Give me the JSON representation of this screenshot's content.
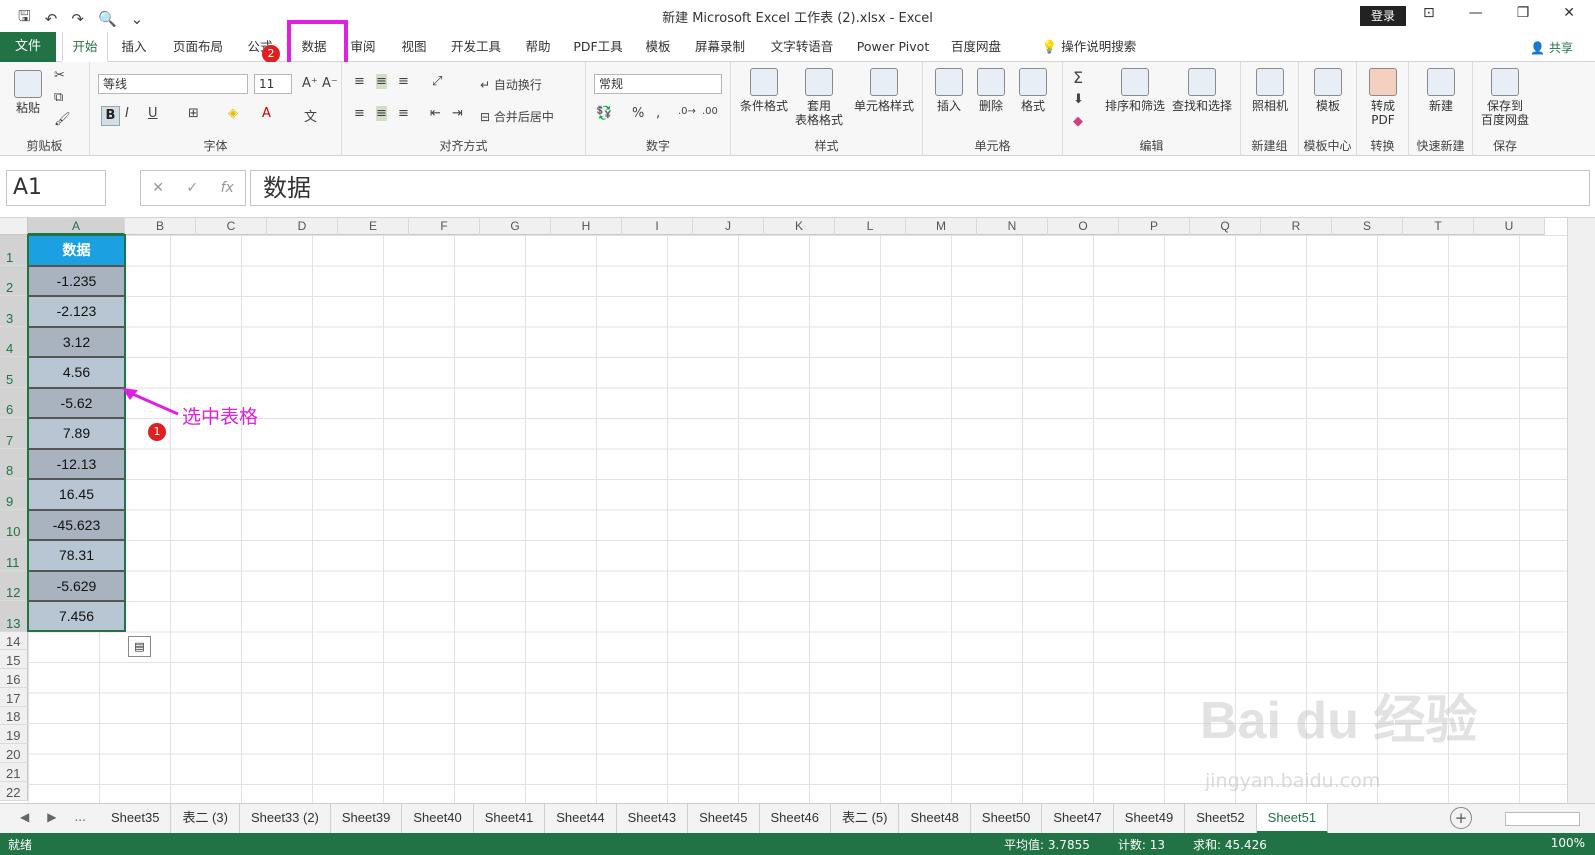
{
  "window": {
    "title": "新建 Microsoft Excel 工作表 (2).xlsx  -  Excel",
    "login_label": "登录",
    "qat_icons": [
      "save-icon",
      "undo-icon",
      "redo-icon",
      "print-preview-icon",
      "customize-icon"
    ]
  },
  "menu": {
    "file_label": "文件",
    "tabs": [
      "开始",
      "插入",
      "页面布局",
      "公式",
      "数据",
      "审阅",
      "视图",
      "开发工具",
      "帮助",
      "PDF工具",
      "模板",
      "屏幕录制",
      "文字转语音",
      "Power Pivot",
      "百度网盘"
    ],
    "active_tab": "开始",
    "search_label": "操作说明搜索",
    "share_label": "共享"
  },
  "ribbon": {
    "clipboard": {
      "label": "剪贴板",
      "paste_label": "粘贴"
    },
    "font": {
      "label": "字体",
      "font_name": "等线",
      "font_size": "11",
      "bold": "B",
      "italic": "I",
      "underline": "U"
    },
    "alignment": {
      "label": "对齐方式",
      "wrap_label": "自动换行",
      "merge_label": "合并后居中"
    },
    "number": {
      "label": "数字",
      "format": "常规",
      "percent": "%",
      "comma": ","
    },
    "styles": {
      "label": "样式",
      "cond_format": "条件格式",
      "table_format": "套用\n表格格式",
      "cell_styles": "单元格样式"
    },
    "cells": {
      "label": "单元格",
      "insert": "插入",
      "delete": "删除",
      "format": "格式"
    },
    "editing": {
      "label": "编辑",
      "sort_filter": "排序和筛选",
      "find_select": "查找和选择"
    },
    "camera": {
      "label": "新建组",
      "btn": "照相机"
    },
    "template": {
      "label": "模板中心",
      "btn": "模板"
    },
    "convert": {
      "label": "转换",
      "btn": "转成\nPDF"
    },
    "quicknew": {
      "label": "快速新建",
      "btn": "新建"
    },
    "save": {
      "label": "保存",
      "btn": "保存到\n百度网盘"
    }
  },
  "formula_bar": {
    "name_box": "A1",
    "fx": "fx",
    "content": "数据"
  },
  "grid": {
    "columns": [
      "A",
      "B",
      "C",
      "D",
      "E",
      "F",
      "G",
      "H",
      "I",
      "J",
      "K",
      "L",
      "M",
      "N",
      "O",
      "P",
      "Q",
      "R",
      "S",
      "T",
      "U"
    ],
    "rows": [
      "1",
      "2",
      "3",
      "4",
      "5",
      "6",
      "7",
      "8",
      "9",
      "10",
      "11",
      "12",
      "13",
      "14",
      "15",
      "16",
      "17",
      "18",
      "19",
      "20",
      "21",
      "22"
    ],
    "colA": [
      "数据",
      "-1.235",
      "-2.123",
      "3.12",
      "4.56",
      "-5.62",
      "7.89",
      "-12.13",
      "16.45",
      "-45.623",
      "78.31",
      "-5.629",
      "7.456"
    ]
  },
  "annotations": {
    "select_label": "选中表格",
    "badge1": "1",
    "badge2": "2",
    "highlight_color": "#e020e0"
  },
  "watermark": {
    "main": "Bai du 经验",
    "sub": "jingyan.baidu.com"
  },
  "sheets": {
    "nav_more": "...",
    "tabs": [
      "Sheet35",
      "表二 (3)",
      "Sheet33 (2)",
      "Sheet39",
      "Sheet40",
      "Sheet41",
      "Sheet44",
      "Sheet43",
      "Sheet45",
      "Sheet46",
      "表二 (5)",
      "Sheet48",
      "Sheet50",
      "Sheet47",
      "Sheet49",
      "Sheet52",
      "Sheet51"
    ],
    "active": "Sheet51"
  },
  "status": {
    "mode": "就绪",
    "average": "平均值: 3.7855",
    "count": "计数: 13",
    "sum": "求和: 45.426",
    "zoom": "100%"
  },
  "colors": {
    "excel_green": "#217346",
    "header_blue": "#1ba1e2",
    "cell_gray": "#a9b3bf"
  }
}
